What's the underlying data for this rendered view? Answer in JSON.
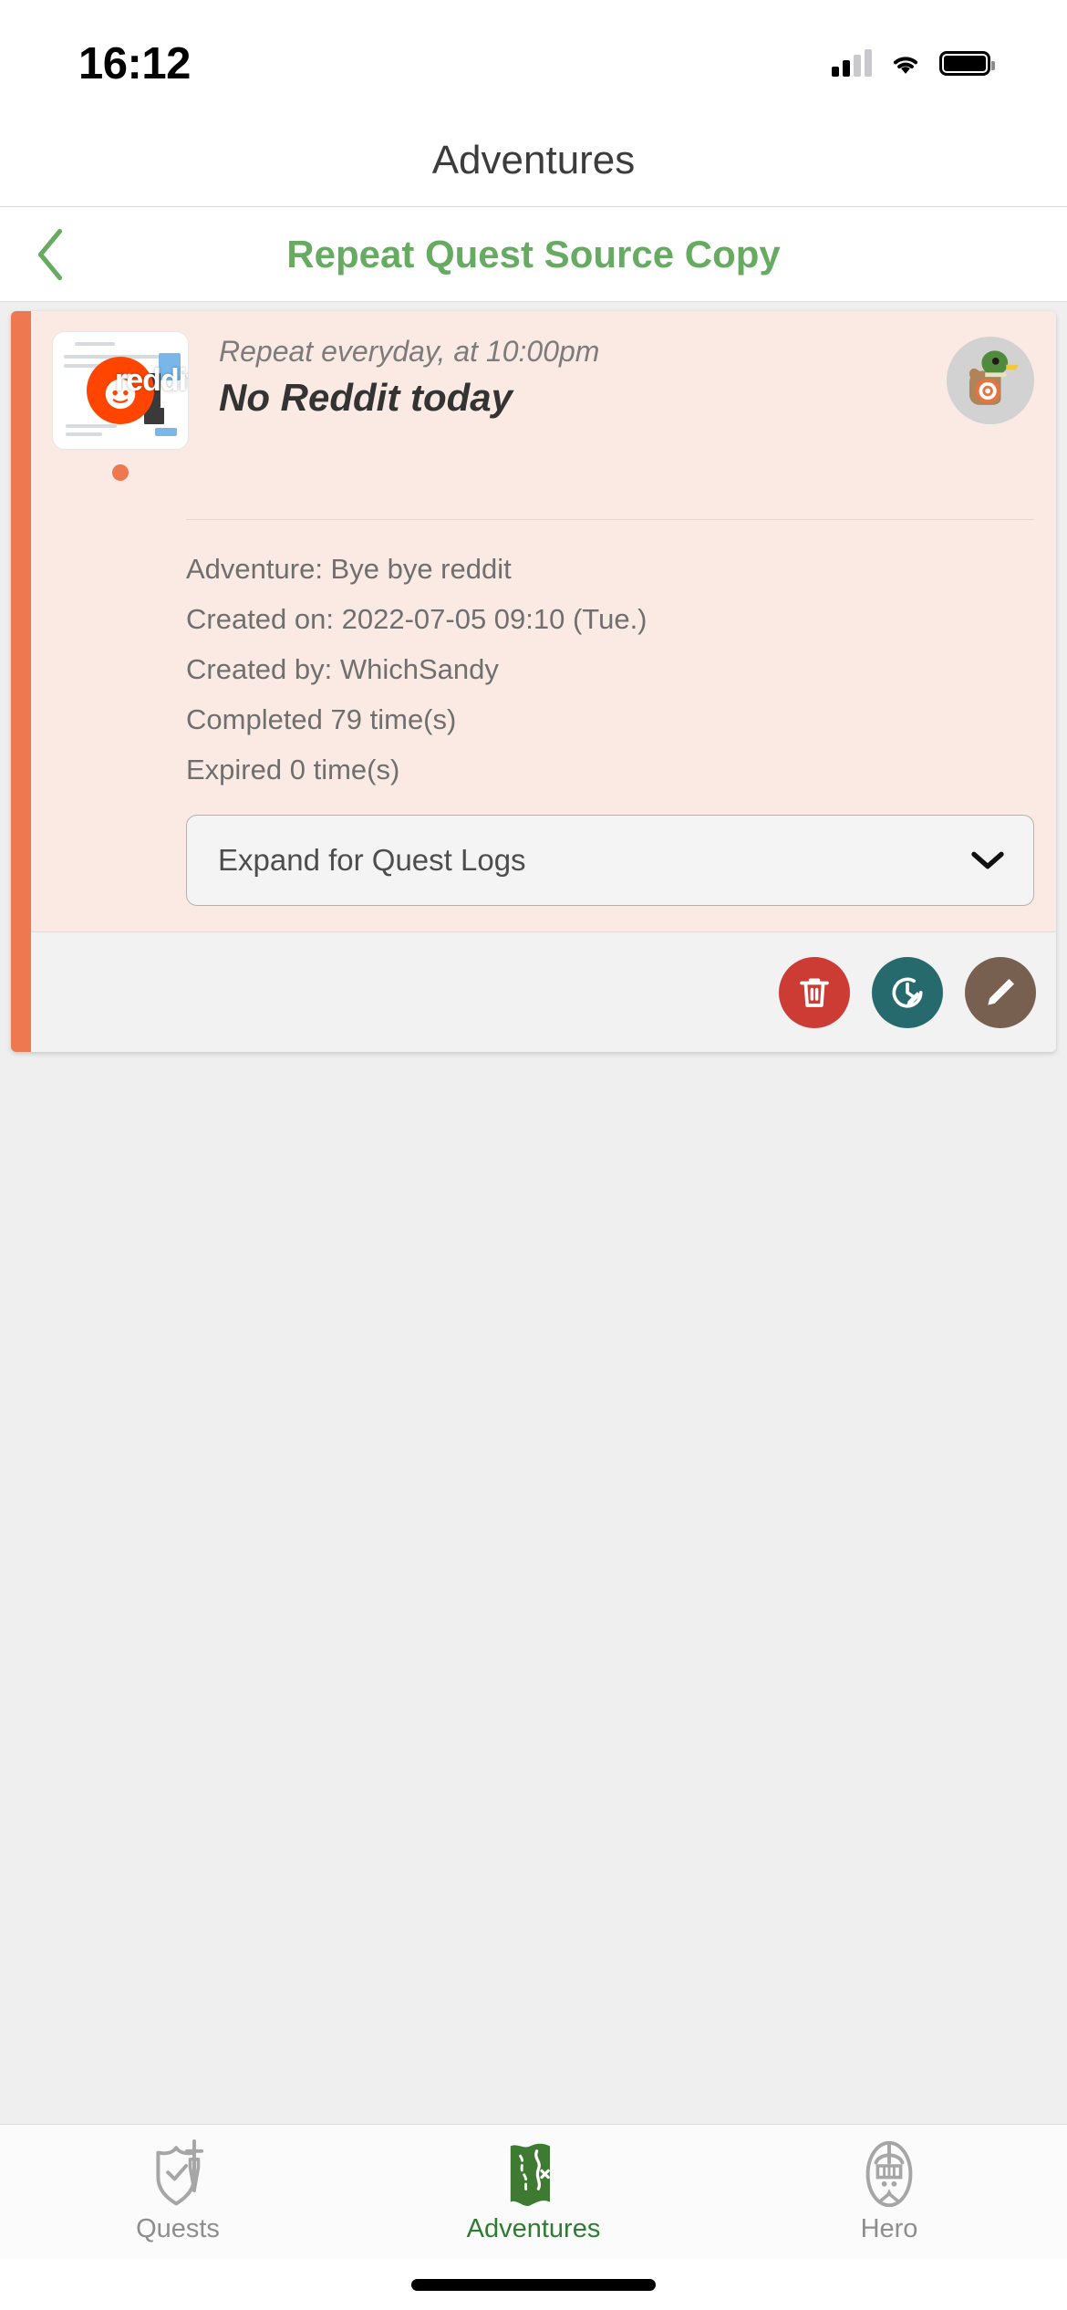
{
  "status_bar": {
    "time": "16:12",
    "signal_icon": "cellular-signal-icon",
    "wifi_icon": "wifi-icon",
    "battery_icon": "battery-full-icon"
  },
  "navbar": {
    "title": "Adventures"
  },
  "subheader": {
    "back_icon": "chevron-left-icon",
    "title": "Repeat Quest Source Copy",
    "title_color": "#67ab62"
  },
  "quest_card": {
    "accent_color": "#ee7850",
    "background_color": "#fbeae3",
    "thumbnail_alt": "reddit",
    "thumbnail_brand": "reddit",
    "status_dot_color": "#ee7850",
    "repeat_line": "Repeat everyday, at 10:00pm",
    "title": "No Reddit today",
    "avatar_icon": "duck-avatar-icon",
    "details": [
      "Adventure: Bye bye reddit",
      "Created on: 2022-07-05 09:10 (Tue.)",
      "Created by: WhichSandy",
      "Completed 79 time(s)",
      "Expired 0 time(s)"
    ],
    "detail_fields": {
      "adventure": "Bye bye reddit",
      "created_on": "2022-07-05 09:10 (Tue.)",
      "created_by": "WhichSandy",
      "completed_count": "79",
      "expired_count": "0"
    },
    "logs_dropdown": {
      "label": "Expand for Quest Logs",
      "chevron_icon": "chevron-down-icon"
    },
    "actions": [
      {
        "name": "delete",
        "icon": "trash-icon",
        "color": "#cc3b34"
      },
      {
        "name": "reschedule",
        "icon": "clock-edit-icon",
        "color": "#266a6e"
      },
      {
        "name": "edit",
        "icon": "pencil-icon",
        "color": "#77604f"
      }
    ]
  },
  "tabbar": {
    "active_color": "#2e7d32",
    "inactive_color": "#8e8e8e",
    "tabs": [
      {
        "label": "Quests",
        "icon": "shield-sword-icon",
        "active": false
      },
      {
        "label": "Adventures",
        "icon": "treasure-map-icon",
        "active": true
      },
      {
        "label": "Hero",
        "icon": "knight-helmet-icon",
        "active": false
      }
    ]
  }
}
